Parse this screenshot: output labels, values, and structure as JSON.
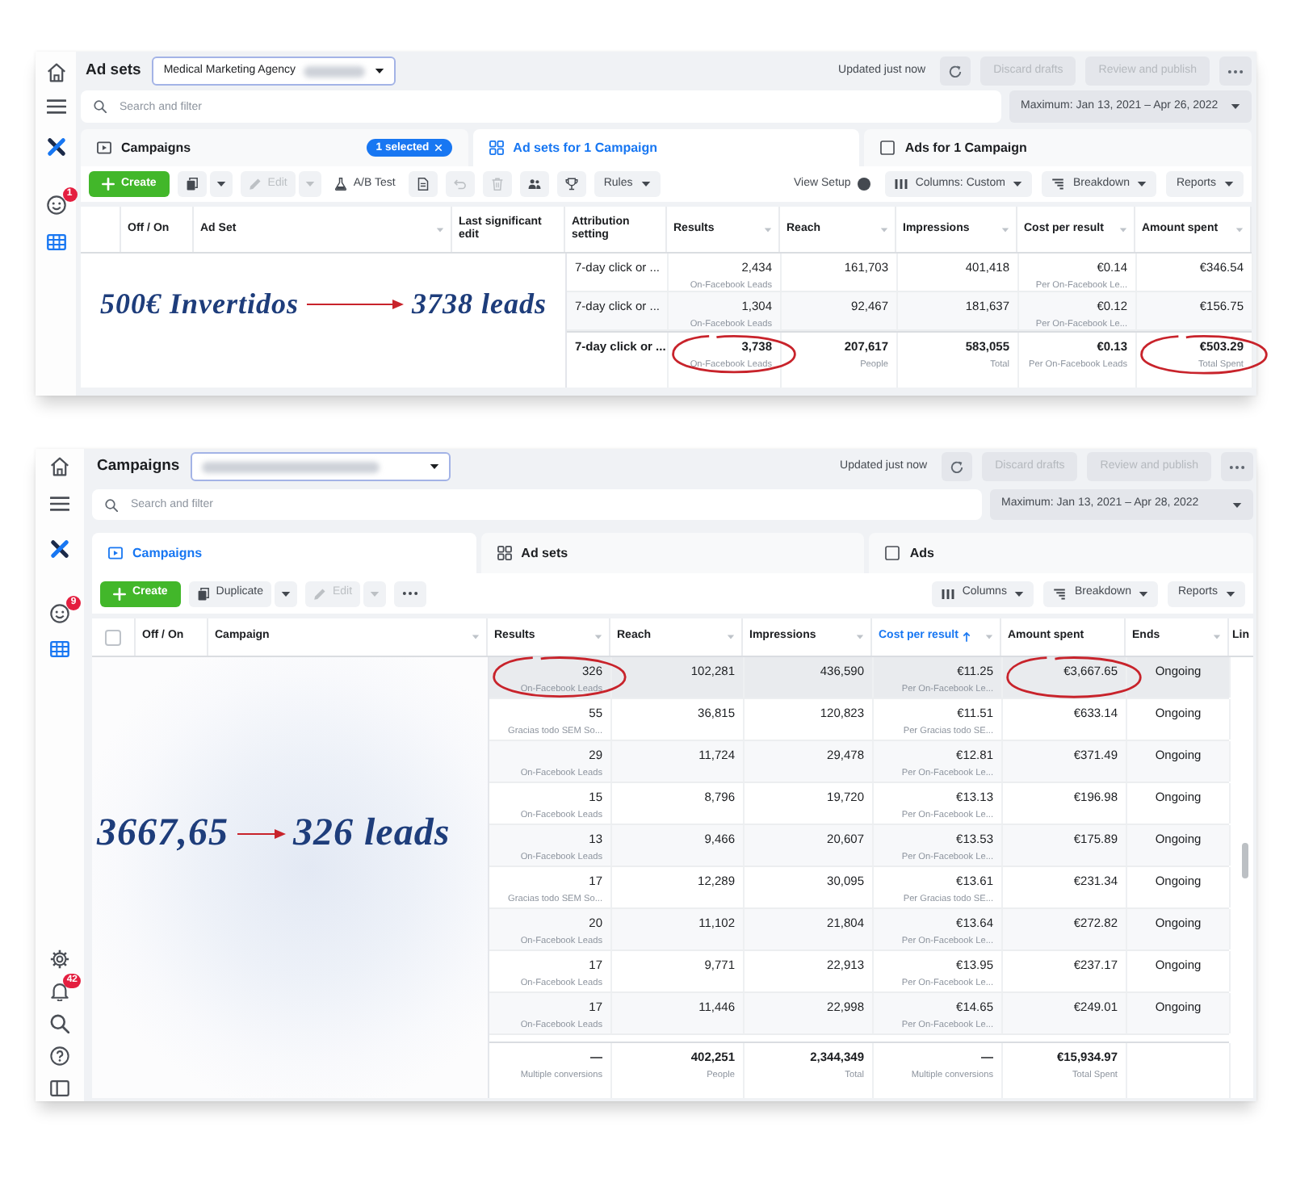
{
  "panels": [
    {
      "sidebar": {
        "top": [
          {
            "selected": false
          },
          {
            "selected": false
          },
          {
            "selected": false
          },
          {
            "selected": false,
            "badge": "1"
          },
          {
            "selected": true
          }
        ]
      },
      "title": "Ad sets",
      "account": {
        "value": "Medical Marketing Agency",
        "redacted": true
      },
      "status": "Updated just now",
      "actions": [
        {
          "label": "Discard drafts",
          "disabled": true
        },
        {
          "label": "Review and publish",
          "disabled": true
        }
      ],
      "search": {
        "placeholder": "Search and filter"
      },
      "date_range": "Maximum: Jan 13, 2021 – Apr 26, 2022",
      "tabs": [
        {
          "label": "Campaigns",
          "selected": false,
          "chip": "1 selected"
        },
        {
          "label": "Ad sets for 1 Campaign",
          "selected": true
        },
        {
          "label": "Ads for 1 Campaign",
          "selected": false
        }
      ],
      "toolbar": {
        "left": [
          {
            "kind": "create",
            "label": "Create"
          },
          {
            "kind": "split",
            "disabled": false
          },
          {
            "kind": "split",
            "label": "Edit",
            "disabled": true
          },
          {
            "kind": "button",
            "label": "A/B Test"
          },
          {
            "kind": "icon",
            "disabled": false
          },
          {
            "kind": "icon",
            "disabled": true
          },
          {
            "kind": "icon",
            "disabled": true
          },
          {
            "kind": "icon",
            "disabled": false
          },
          {
            "kind": "icon",
            "disabled": false
          },
          {
            "kind": "menu",
            "label": "Rules"
          }
        ],
        "right": [
          {
            "kind": "toggle",
            "label": "View Setup"
          },
          {
            "kind": "menu",
            "label": "Columns: Custom"
          },
          {
            "kind": "menu",
            "label": "Breakdown"
          },
          {
            "kind": "menu",
            "label": "Reports"
          }
        ]
      },
      "table": {
        "columns": [
          {
            "label": "Off / On",
            "kind": "text",
            "menu": false,
            "sorted": false
          },
          {
            "label": "Ad Set",
            "kind": "text",
            "menu": true,
            "sorted": false
          },
          {
            "label": "Last significant edit",
            "kind": "text",
            "menu": false,
            "sorted": false
          },
          {
            "label": "Attribution setting",
            "kind": "text",
            "menu": false,
            "sorted": false
          },
          {
            "label": "Results",
            "kind": "metric",
            "menu": true,
            "sorted": false
          },
          {
            "label": "Reach",
            "kind": "metric",
            "menu": true,
            "sorted": false
          },
          {
            "label": "Impressions",
            "kind": "metric",
            "menu": true,
            "sorted": false
          },
          {
            "label": "Cost per result",
            "kind": "metric",
            "menu": true,
            "sorted": false
          },
          {
            "label": "Amount spent",
            "kind": "metric",
            "menu": true,
            "sorted": false
          }
        ],
        "rows": [
          {
            "highlighted": false,
            "cells": [
              "",
              "",
              "",
              {
                "value": "7-day click or ..."
              },
              {
                "value": "2,434",
                "caption": "On-Facebook Leads"
              },
              {
                "value": "161,703"
              },
              {
                "value": "401,418"
              },
              {
                "value": "€0.14",
                "caption": "Per On-Facebook Le..."
              },
              {
                "value": "€346.54"
              }
            ]
          },
          {
            "highlighted": false,
            "cells": [
              "",
              "",
              "",
              {
                "value": "7-day click or ..."
              },
              {
                "value": "1,304",
                "caption": "On-Facebook Leads"
              },
              {
                "value": "92,467"
              },
              {
                "value": "181,637"
              },
              {
                "value": "€0.12",
                "caption": "Per On-Facebook Le..."
              },
              {
                "value": "€156.75"
              }
            ]
          }
        ],
        "totals": {
          "cells": [
            "",
            "",
            "",
            {
              "value": "7-day click or ..."
            },
            {
              "value": "3,738",
              "caption": "On-Facebook Leads",
              "circled": true
            },
            {
              "value": "207,617",
              "caption": "People"
            },
            {
              "value": "583,055",
              "caption": "Total"
            },
            {
              "value": "€0.13",
              "caption": "Per On-Facebook Leads"
            },
            {
              "value": "€503.29",
              "caption": "Total Spent",
              "circled": true
            }
          ]
        }
      },
      "annotation": {
        "from": "500€ Invertidos",
        "to": "3738 leads"
      }
    },
    {
      "sidebar": {
        "top": [
          {
            "selected": false
          },
          {
            "selected": false
          },
          {
            "selected": false
          },
          {
            "selected": false,
            "badge": "9"
          },
          {
            "selected": true
          }
        ],
        "bottom": [
          {
            "selected": false
          },
          {
            "selected": false,
            "badge": "42"
          },
          {
            "selected": false
          },
          {
            "selected": false
          },
          {
            "selected": false
          }
        ]
      },
      "title": "Campaigns",
      "account": {
        "redacted": true
      },
      "status": "Updated just now",
      "actions": [
        {
          "label": "Discard drafts",
          "disabled": true
        },
        {
          "label": "Review and publish",
          "disabled": true
        }
      ],
      "search": {
        "placeholder": "Search and filter"
      },
      "date_range": "Maximum: Jan 13, 2021 – Apr 28, 2022",
      "tabs": [
        {
          "label": "Campaigns",
          "selected": true
        },
        {
          "label": "Ad sets",
          "selected": false
        },
        {
          "label": "Ads",
          "selected": false
        }
      ],
      "toolbar": {
        "left": [
          {
            "kind": "create",
            "label": "Create"
          },
          {
            "kind": "split",
            "label": "Duplicate",
            "disabled": false
          },
          {
            "kind": "split",
            "label": "Edit",
            "disabled": true
          },
          {
            "kind": "more"
          }
        ],
        "right": [
          {
            "kind": "menu",
            "label": "Columns"
          },
          {
            "kind": "menu",
            "label": "Breakdown"
          },
          {
            "kind": "menu",
            "label": "Reports"
          }
        ]
      },
      "table": {
        "select_all": {
          "checked": false
        },
        "names_redacted": true,
        "columns": [
          {
            "label": "Off / On",
            "kind": "text",
            "menu": false,
            "sorted": false
          },
          {
            "label": "Campaign",
            "kind": "text",
            "menu": true,
            "sorted": false
          },
          {
            "label": "Results",
            "kind": "metric",
            "menu": true,
            "sorted": false
          },
          {
            "label": "Reach",
            "kind": "metric",
            "menu": true,
            "sorted": false
          },
          {
            "label": "Impressions",
            "kind": "metric",
            "menu": true,
            "sorted": false
          },
          {
            "label": "Cost per result",
            "kind": "metric",
            "menu": true,
            "sorted": true
          },
          {
            "label": "Amount spent",
            "kind": "metric",
            "menu": false,
            "sorted": false
          },
          {
            "label": "Ends",
            "kind": "status",
            "menu": true,
            "sorted": false
          },
          {
            "label": "Lin",
            "kind": "text",
            "sorted": false
          }
        ],
        "rows": [
          {
            "highlighted": true,
            "cells": [
              "",
              "",
              {
                "value": "326",
                "caption": "On-Facebook Leads",
                "circled": true
              },
              {
                "value": "102,281"
              },
              {
                "value": "436,590"
              },
              {
                "value": "€11.25",
                "caption": "Per On-Facebook Le..."
              },
              {
                "value": "€3,667.65",
                "circled": true
              },
              {
                "value": "Ongoing"
              }
            ]
          },
          {
            "highlighted": false,
            "cells": [
              "",
              "",
              {
                "value": "55",
                "caption": "Gracias todo SEM So..."
              },
              {
                "value": "36,815"
              },
              {
                "value": "120,823"
              },
              {
                "value": "€11.51",
                "caption": "Per Gracias todo SE..."
              },
              {
                "value": "€633.14"
              },
              {
                "value": "Ongoing"
              }
            ]
          },
          {
            "highlighted": false,
            "cells": [
              "",
              "",
              {
                "value": "29",
                "caption": "On-Facebook Leads"
              },
              {
                "value": "11,724"
              },
              {
                "value": "29,478"
              },
              {
                "value": "€12.81",
                "caption": "Per On-Facebook Le..."
              },
              {
                "value": "€371.49"
              },
              {
                "value": "Ongoing"
              }
            ]
          },
          {
            "highlighted": false,
            "cells": [
              "",
              "",
              {
                "value": "15",
                "caption": "On-Facebook Leads"
              },
              {
                "value": "8,796"
              },
              {
                "value": "19,720"
              },
              {
                "value": "€13.13",
                "caption": "Per On-Facebook Le..."
              },
              {
                "value": "€196.98"
              },
              {
                "value": "Ongoing"
              }
            ]
          },
          {
            "highlighted": false,
            "cells": [
              "",
              "",
              {
                "value": "13",
                "caption": "On-Facebook Leads"
              },
              {
                "value": "9,466"
              },
              {
                "value": "20,607"
              },
              {
                "value": "€13.53",
                "caption": "Per On-Facebook Le..."
              },
              {
                "value": "€175.89"
              },
              {
                "value": "Ongoing"
              }
            ]
          },
          {
            "highlighted": false,
            "cells": [
              "",
              "",
              {
                "value": "17",
                "caption": "Gracias todo SEM So..."
              },
              {
                "value": "12,289"
              },
              {
                "value": "30,095"
              },
              {
                "value": "€13.61",
                "caption": "Per Gracias todo SE..."
              },
              {
                "value": "€231.34"
              },
              {
                "value": "Ongoing"
              }
            ]
          },
          {
            "highlighted": false,
            "cells": [
              "",
              "",
              {
                "value": "20",
                "caption": "On-Facebook Leads"
              },
              {
                "value": "11,102"
              },
              {
                "value": "21,804"
              },
              {
                "value": "€13.64",
                "caption": "Per On-Facebook Le..."
              },
              {
                "value": "€272.82"
              },
              {
                "value": "Ongoing"
              }
            ]
          },
          {
            "highlighted": false,
            "cells": [
              "",
              "",
              {
                "value": "17",
                "caption": "On-Facebook Leads"
              },
              {
                "value": "9,771"
              },
              {
                "value": "22,913"
              },
              {
                "value": "€13.95",
                "caption": "Per On-Facebook Le..."
              },
              {
                "value": "€237.17"
              },
              {
                "value": "Ongoing"
              }
            ]
          },
          {
            "highlighted": false,
            "cells": [
              "",
              "",
              {
                "value": "17",
                "caption": "On-Facebook Leads"
              },
              {
                "value": "11,446"
              },
              {
                "value": "22,998"
              },
              {
                "value": "€14.65",
                "caption": "Per On-Facebook Le..."
              },
              {
                "value": "€249.01"
              },
              {
                "value": "Ongoing"
              }
            ]
          }
        ],
        "totals": {
          "cells": [
            "",
            "",
            {
              "value": "—",
              "caption": "Multiple conversions"
            },
            {
              "value": "402,251",
              "caption": "People"
            },
            {
              "value": "2,344,349",
              "caption": "Total"
            },
            {
              "value": "—",
              "caption": "Multiple conversions"
            },
            {
              "value": "€15,934.97",
              "caption": "Total Spent"
            }
          ]
        }
      },
      "annotation": {
        "from": "3667,65",
        "to": "326 leads"
      }
    }
  ]
}
